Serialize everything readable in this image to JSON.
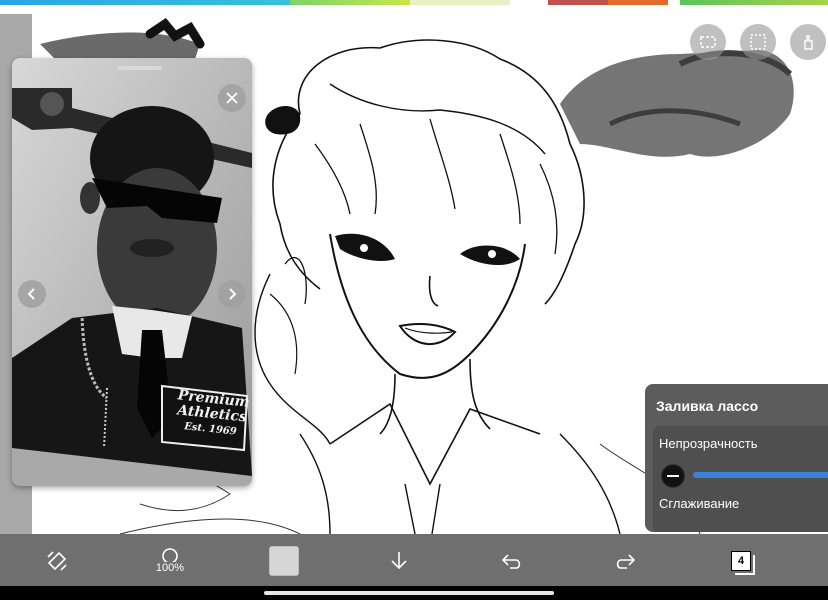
{
  "colors": {
    "canvas": "#ffffff",
    "toolbar": "#6f6f6f",
    "panel": "#5c5c5c",
    "slider": "#3b82d6"
  },
  "reference": {
    "photo_text_line1": "Premium",
    "photo_text_line2": "Athletics",
    "photo_text_line3": "Est. 1969",
    "close_icon": "close-icon",
    "prev_icon": "chevron-left-icon",
    "next_icon": "chevron-right-icon"
  },
  "lasso_fill": {
    "title": "Заливка лассо",
    "opacity_label": "Непрозрачность",
    "smoothing_label": "Сглаживание"
  },
  "toolbar": {
    "brush_size": "100%",
    "layers_count": "4",
    "icons": [
      "transform-icon",
      "brush-size-icon",
      "color-swatch",
      "download-icon",
      "undo-icon",
      "redo-icon",
      "layers-icon"
    ]
  }
}
